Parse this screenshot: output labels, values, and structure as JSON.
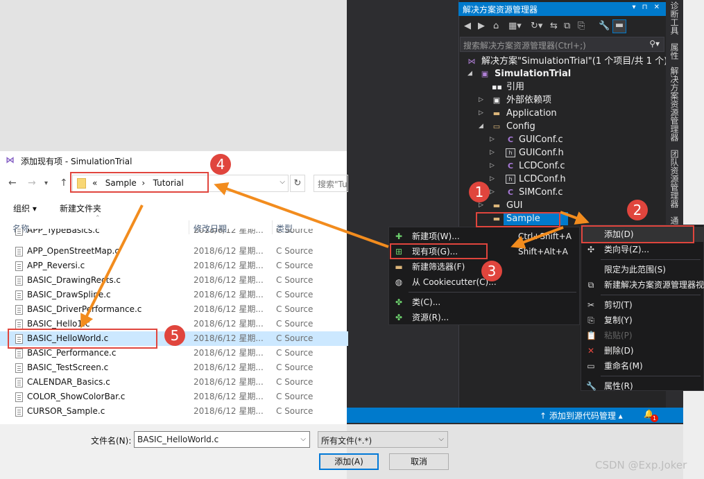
{
  "solution_explorer": {
    "title": "解决方案资源管理器",
    "title_buttons": "▾ ⊓ ✕",
    "search_placeholder": "搜索解决方案资源管理器(Ctrl+;)",
    "tree": [
      {
        "label": "解决方案\"SimulationTrial\"(1 个项目/共 1 个)",
        "icon": "solution-icon",
        "arrow": ""
      },
      {
        "label": "SimulationTrial",
        "icon": "project-icon",
        "arrow": "◢",
        "bold": true
      },
      {
        "label": "引用",
        "icon": "references-icon",
        "arrow": ""
      },
      {
        "label": "外部依赖项",
        "icon": "external-deps-icon",
        "arrow": "▷"
      },
      {
        "label": "Application",
        "icon": "folder-icon",
        "arrow": "▷"
      },
      {
        "label": "Config",
        "icon": "folder-open-icon",
        "arrow": "◢"
      },
      {
        "label": "GUIConf.c",
        "icon": "c-file-icon",
        "arrow": "▷"
      },
      {
        "label": "GUIConf.h",
        "icon": "h-file-icon",
        "arrow": "▷"
      },
      {
        "label": "LCDConf.c",
        "icon": "c-file-icon",
        "arrow": "▷"
      },
      {
        "label": "LCDConf.h",
        "icon": "h-file-icon",
        "arrow": "▷"
      },
      {
        "label": "SIMConf.c",
        "icon": "c-file-icon",
        "arrow": "▷"
      },
      {
        "label": "GUI",
        "icon": "folder-icon",
        "arrow": "▷"
      },
      {
        "label": "Sample",
        "icon": "folder-icon",
        "arrow": "",
        "selected": true
      }
    ],
    "side_tabs": [
      "诊断工具",
      "属性",
      "解决方案资源管理器",
      "团队资源管理器",
      "通"
    ],
    "status_text": "↑ 添加到源代码管理 ▴",
    "notification_count": "1"
  },
  "context_menu_main": [
    {
      "label": "添加(D)",
      "icon": "",
      "highlight": true
    },
    {
      "label": "类向导(Z)...",
      "icon": "class-wizard-icon"
    },
    {
      "sep": true
    },
    {
      "label": "限定为此范围(S)",
      "icon": ""
    },
    {
      "label": "新建解决方案资源管理器视",
      "icon": "new-view-icon"
    },
    {
      "sep": true
    },
    {
      "label": "剪切(T)",
      "icon": "cut-icon"
    },
    {
      "label": "复制(Y)",
      "icon": "copy-icon"
    },
    {
      "label": "粘贴(P)",
      "icon": "paste-icon",
      "disabled": true
    },
    {
      "label": "删除(D)",
      "icon": "delete-icon"
    },
    {
      "label": "重命名(M)",
      "icon": "rename-icon"
    },
    {
      "sep": true
    },
    {
      "label": "属性(R)",
      "icon": "properties-icon"
    }
  ],
  "context_menu_add": [
    {
      "label": "新建项(W)...",
      "shortcut": "Ctrl+Shift+A",
      "icon": "new-item-icon"
    },
    {
      "label": "现有项(G)...",
      "shortcut": "Shift+Alt+A",
      "icon": "existing-item-icon",
      "highlight": true
    },
    {
      "label": "新建筛选器(F)",
      "shortcut": "",
      "icon": "new-filter-icon"
    },
    {
      "label": "从 Cookiecutter(C)...",
      "shortcut": "",
      "icon": "cookiecutter-icon"
    },
    {
      "sep": true
    },
    {
      "label": "类(C)...",
      "shortcut": "",
      "icon": "class-icon"
    },
    {
      "label": "资源(R)...",
      "shortcut": "",
      "icon": "resource-icon"
    }
  ],
  "dialog": {
    "title": "添加现有项 - SimulationTrial",
    "path_prefix": "«",
    "path": [
      "Sample",
      "Tutorial"
    ],
    "search_placeholder": "搜索\"Tuto",
    "organize": "组织 ▾",
    "new_folder": "新建文件夹",
    "col_name": "名称",
    "col_date": "修改日期",
    "col_type": "类型",
    "files": [
      {
        "name": "APP_TypeBasics.c",
        "date": "2018/6/12 星期...",
        "type": "C Source"
      },
      {
        "name": "APP_OpenStreetMap.c",
        "date": "2018/6/12 星期...",
        "type": "C Source"
      },
      {
        "name": "APP_Reversi.c",
        "date": "2018/6/12 星期...",
        "type": "C Source"
      },
      {
        "name": "BASIC_DrawingRects.c",
        "date": "2018/6/12 星期...",
        "type": "C Source"
      },
      {
        "name": "BASIC_DrawSpline.c",
        "date": "2018/6/12 星期...",
        "type": "C Source"
      },
      {
        "name": "BASIC_DriverPerformance.c",
        "date": "2018/6/12 星期...",
        "type": "C Source"
      },
      {
        "name": "BASIC_Hello1.c",
        "date": "2018/6/12 星期...",
        "type": "C Source"
      },
      {
        "name": "BASIC_HelloWorld.c",
        "date": "2018/6/12 星期...",
        "type": "C Source",
        "selected": true
      },
      {
        "name": "BASIC_Performance.c",
        "date": "2018/6/12 星期...",
        "type": "C Source"
      },
      {
        "name": "BASIC_TestScreen.c",
        "date": "2018/6/12 星期...",
        "type": "C Source"
      },
      {
        "name": "CALENDAR_Basics.c",
        "date": "2018/6/12 星期...",
        "type": "C Source"
      },
      {
        "name": "COLOR_ShowColorBar.c",
        "date": "2018/6/12 星期...",
        "type": "C Source"
      },
      {
        "name": "CURSOR_Sample.c",
        "date": "2018/6/12 星期...",
        "type": "C Source"
      }
    ],
    "filename_label": "文件名(N):",
    "filename_value": "BASIC_HelloWorld.c",
    "filetype_value": "所有文件(*.*)",
    "add_button": "添加(A)",
    "cancel_button": "取消"
  },
  "annotations": [
    "1",
    "2",
    "3",
    "4",
    "5"
  ],
  "watermark": "CSDN @Exp.Joker",
  "colors": {
    "accent": "#007acc",
    "annotation": "#e0453d",
    "arrow": "#f28c1e",
    "selection": "#cce8ff"
  }
}
